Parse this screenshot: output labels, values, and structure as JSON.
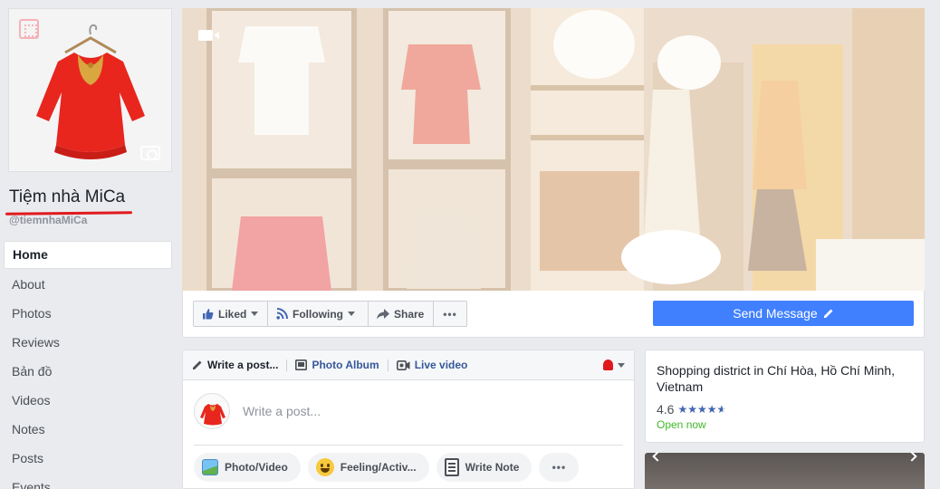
{
  "page": {
    "name": "Tiệm nhà MiCa",
    "handle": "@tiemnhaMiCa"
  },
  "nav": {
    "items": [
      {
        "label": "Home",
        "active": true
      },
      {
        "label": "About"
      },
      {
        "label": "Photos"
      },
      {
        "label": "Reviews"
      },
      {
        "label": "Bản đồ"
      },
      {
        "label": "Videos"
      },
      {
        "label": "Notes"
      },
      {
        "label": "Posts"
      },
      {
        "label": "Events"
      }
    ]
  },
  "actions": {
    "liked_label": "Liked",
    "following_label": "Following",
    "share_label": "Share",
    "more_label": "•••",
    "send_message_label": "Send Message"
  },
  "composer": {
    "tabs": [
      {
        "label": "Write a post...",
        "icon": "pencil-icon"
      },
      {
        "label": "Photo Album",
        "icon": "album-icon"
      },
      {
        "label": "Live video",
        "icon": "video-icon"
      }
    ],
    "placeholder": "Write a post...",
    "pills": [
      {
        "label": "Photo/Video",
        "icon": "photo-icon"
      },
      {
        "label": "Feeling/Activ...",
        "icon": "feeling-icon"
      },
      {
        "label": "Write Note",
        "icon": "note-icon"
      }
    ],
    "more_label": "•••"
  },
  "info": {
    "address": "Shopping district in Chí Hòa, Hồ Chí Minh, Vietnam",
    "rating": "4.6",
    "rating_fraction": 0.92,
    "stars": "★★★★★",
    "status": "Open now"
  },
  "colors": {
    "accent_blue": "#4080ff",
    "link_blue": "#365899",
    "star_blue": "#4267b2",
    "open_green": "#42b72a",
    "title_underline": "#e0191e"
  }
}
